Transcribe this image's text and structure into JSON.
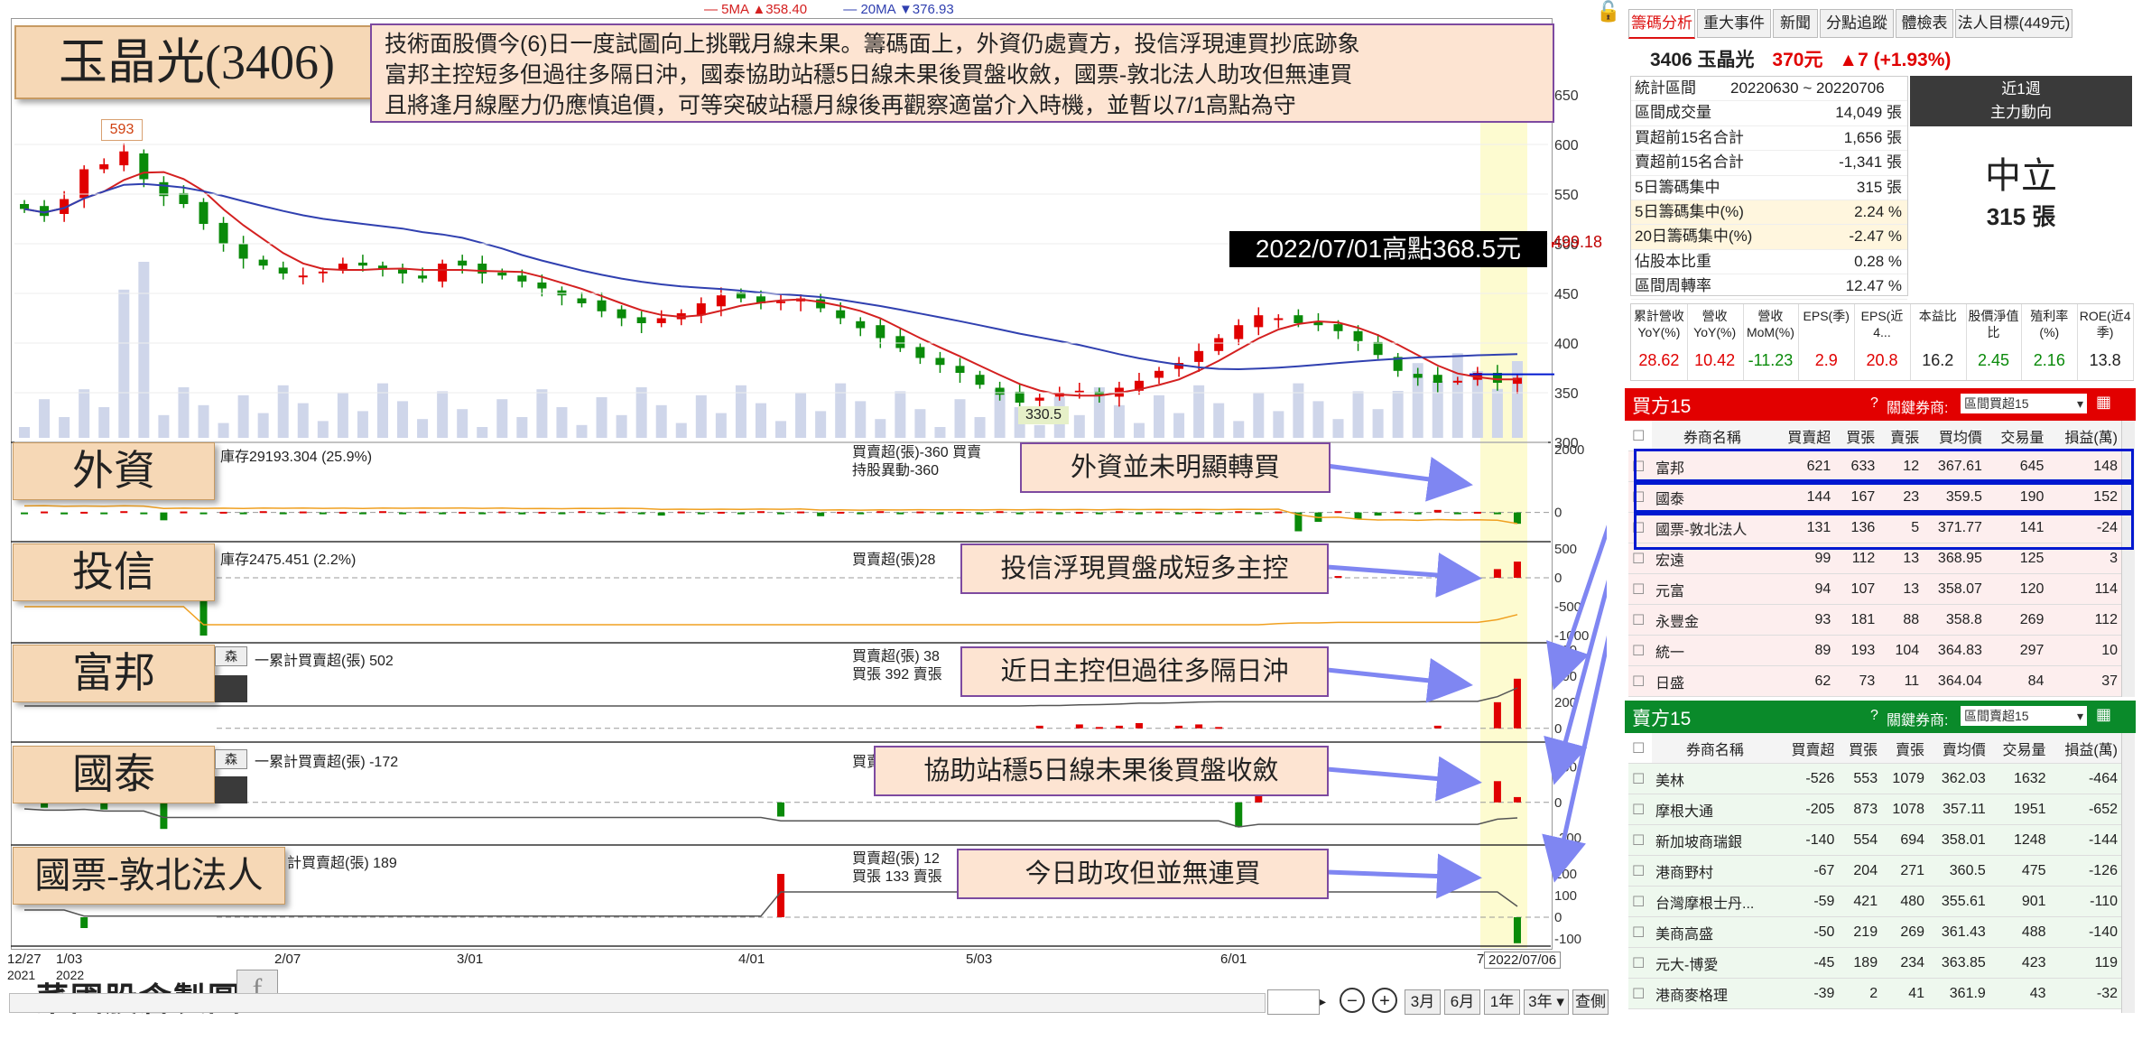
{
  "title": "玉晶光(3406)",
  "comment_lines": [
    "技術面股價今(6)日一度試圖向上挑戰月線未果。籌碼面上，外資仍處賣方，投信浮現連買抄底跡象",
    "富邦主控短多但過往多隔日沖，國泰協助站穩5日線未果後買盤收斂，國票-敦北法人助攻但無連買",
    "且將逢月線壓力仍應慎追價，可等突破站穩月線後再觀察適當介入時機，並暫以7/1高點為守"
  ],
  "ma_legend": {
    "ma5": "5MA ▲358.40",
    "ma20": "20MA ▼376.93"
  },
  "price_high_label": "593",
  "price_low_label": "330.5",
  "price_marker": "499.18",
  "high_callout": "2022/07/01高點368.5元",
  "panel_labels": [
    "外資",
    "投信",
    "富邦",
    "國泰",
    "國票-敦北法人"
  ],
  "callouts": [
    "外資並未明顯轉買",
    "投信浮現買盤成短多主控",
    "近日主控但過往多隔日沖",
    "協助站穩5日線未果後買盤收斂",
    "今日助攻但並無連買"
  ],
  "panel_info": {
    "foreign_left": "庫存29193.304 (25.9%)",
    "foreign_mid1": "買賣超(張)-360 買賣",
    "foreign_mid2": "持股異動-360",
    "trust_left": "庫存2475.451 (2.2%)",
    "trust_mid": "買賣超(張)28",
    "fubon_left": "一累計買賣超(張) 502",
    "fubon_mid1": "買賣超(張) 38",
    "fubon_mid2": "買張 392 賣張",
    "cathay_left": "一累計買賣超(張) -172",
    "cathay_mid": "買賣超(張)",
    "pbl_left": "計買賣超(張) 189",
    "pbl_mid1": "買賣超(張) 12",
    "pbl_mid2": "買張 133 賣張",
    "small_btn": "森"
  },
  "x_axis": {
    "labels": [
      "12/27",
      "1/03",
      "2/07",
      "3/01",
      "4/01",
      "5/03",
      "6/01",
      "7"
    ],
    "year_labels": [
      "2021",
      "2022"
    ],
    "current_date": "2022/07/06"
  },
  "watermark": "菜圃股倉製圖",
  "bottom_buttons": [
    "3月",
    "6月",
    "1年",
    "3年",
    "查側"
  ],
  "chart_data": [
    {
      "type": "candlestick",
      "title": "",
      "x_range": [
        "2021/12/27",
        "2022/07/06"
      ],
      "ylim": [
        300,
        650
      ],
      "y_ticks": [
        300,
        350,
        400,
        450,
        500,
        550,
        600,
        650
      ],
      "annotations": {
        "high": 593,
        "low": 330.5,
        "marker": 499.18,
        "ma5": 358.4,
        "ma20": 376.93
      },
      "close_path": [
        535,
        528,
        545,
        575,
        580,
        593,
        565,
        548,
        540,
        520,
        500,
        485,
        478,
        470,
        468,
        472,
        480,
        478,
        475,
        470,
        465,
        480,
        478,
        470,
        468,
        462,
        455,
        448,
        440,
        432,
        425,
        420,
        425,
        430,
        440,
        448,
        445,
        440,
        442,
        445,
        435,
        425,
        415,
        405,
        395,
        385,
        378,
        370,
        358,
        348,
        340,
        345,
        350,
        352,
        348,
        355,
        362,
        372,
        380,
        392,
        405,
        418,
        428,
        425,
        420,
        418,
        412,
        402,
        388,
        372,
        365,
        360,
        362,
        370,
        360,
        365
      ],
      "series": [
        {
          "name": "5MA",
          "color": "#d42020"
        },
        {
          "name": "20MA",
          "color": "#3040b0"
        }
      ]
    },
    {
      "type": "bar",
      "title": "外資",
      "values": [
        -40,
        30,
        -60,
        20,
        -20,
        40,
        -30,
        -250,
        30,
        -20,
        20,
        -30,
        40,
        -20,
        30,
        -40,
        20,
        -30,
        40,
        -20,
        30,
        -20,
        20,
        -40,
        30,
        -60,
        20,
        -30,
        40,
        -20,
        30,
        -20,
        -100,
        30,
        -20,
        20,
        -30,
        40,
        -20,
        30,
        -120,
        20,
        -30,
        40,
        -20,
        30,
        -20,
        20,
        -30,
        40,
        -20,
        30,
        -20,
        20,
        -30,
        40,
        -20,
        30,
        -20,
        20,
        -30,
        40,
        -20,
        30,
        -600,
        -300,
        40,
        -200,
        -100,
        30,
        -60,
        80,
        -50,
        20,
        -40,
        -360
      ],
      "ylim": [
        -700,
        2000
      ],
      "y_ticks": [
        0,
        2000
      ]
    },
    {
      "type": "bar",
      "title": "投信",
      "values": [
        0,
        0,
        0,
        0,
        0,
        0,
        0,
        0,
        0,
        -1000,
        0,
        0,
        0,
        0,
        0,
        0,
        0,
        0,
        0,
        0,
        0,
        0,
        0,
        0,
        0,
        0,
        0,
        0,
        0,
        0,
        0,
        0,
        0,
        0,
        0,
        0,
        0,
        0,
        0,
        0,
        0,
        0,
        0,
        0,
        0,
        0,
        0,
        0,
        0,
        0,
        0,
        0,
        0,
        0,
        0,
        0,
        0,
        0,
        0,
        0,
        0,
        0,
        0,
        60,
        40,
        0,
        30,
        0,
        0,
        0,
        0,
        0,
        0,
        0,
        150,
        280
      ],
      "ylim": [
        -1000,
        500
      ],
      "y_ticks": [
        500,
        0,
        -500,
        -1000
      ]
    },
    {
      "type": "bar",
      "title": "富邦",
      "values": [
        0,
        0,
        0,
        0,
        0,
        0,
        0,
        0,
        0,
        0,
        0,
        0,
        0,
        0,
        0,
        0,
        0,
        0,
        0,
        0,
        0,
        0,
        0,
        0,
        0,
        0,
        0,
        0,
        0,
        0,
        0,
        0,
        0,
        0,
        0,
        0,
        0,
        0,
        0,
        0,
        0,
        0,
        0,
        0,
        0,
        0,
        0,
        0,
        0,
        0,
        0,
        20,
        0,
        30,
        10,
        20,
        40,
        0,
        20,
        30,
        10,
        0,
        0,
        0,
        0,
        0,
        0,
        0,
        0,
        0,
        0,
        20,
        0,
        0,
        200,
        380
      ],
      "ylim": [
        -50,
        600
      ],
      "y_ticks": [
        0,
        200,
        400,
        600
      ]
    },
    {
      "type": "bar",
      "title": "國泰",
      "values": [
        0,
        -30,
        0,
        20,
        -40,
        0,
        0,
        -150,
        0,
        0,
        0,
        0,
        0,
        0,
        0,
        0,
        0,
        0,
        0,
        0,
        0,
        0,
        0,
        0,
        0,
        0,
        0,
        0,
        0,
        0,
        0,
        0,
        0,
        0,
        0,
        0,
        0,
        0,
        -80,
        0,
        0,
        0,
        0,
        0,
        0,
        0,
        0,
        0,
        0,
        0,
        0,
        0,
        0,
        0,
        0,
        0,
        0,
        0,
        0,
        0,
        0,
        -140,
        60,
        0,
        0,
        0,
        0,
        0,
        0,
        0,
        0,
        0,
        0,
        0,
        120,
        30
      ],
      "ylim": [
        -200,
        300
      ],
      "y_ticks": [
        200,
        0,
        -200
      ]
    },
    {
      "type": "bar",
      "title": "國票-敦北法人",
      "values": [
        0,
        0,
        0,
        -50,
        0,
        0,
        0,
        0,
        0,
        0,
        0,
        0,
        0,
        0,
        0,
        0,
        0,
        0,
        0,
        0,
        0,
        0,
        0,
        0,
        0,
        0,
        0,
        0,
        0,
        0,
        0,
        0,
        0,
        0,
        0,
        0,
        0,
        0,
        200,
        0,
        0,
        0,
        0,
        0,
        0,
        0,
        0,
        0,
        0,
        0,
        0,
        0,
        0,
        0,
        0,
        0,
        0,
        0,
        0,
        0,
        0,
        0,
        0,
        0,
        0,
        0,
        0,
        0,
        0,
        0,
        0,
        0,
        0,
        0,
        0,
        -120
      ],
      "ylim": [
        -100,
        300
      ],
      "y_ticks": [
        300,
        200,
        100,
        0,
        -100
      ]
    }
  ],
  "right_panel": {
    "tabs": [
      "籌碼分析",
      "重大事件",
      "新聞",
      "分點追蹤",
      "體檢表",
      "法人目標(449元)"
    ],
    "stock_code_name": "3406 玉晶光",
    "price": "370元",
    "change": "▲7 (+1.93%)",
    "stats": [
      [
        "統計區間",
        "20220630 ~ 20220706"
      ],
      [
        "區間成交量",
        "14,049 張"
      ],
      [
        "買超前15名合計",
        "1,656 張"
      ],
      [
        "賣超前15名合計",
        "-1,341 張"
      ],
      [
        "5日籌碼集中",
        "315 張"
      ],
      [
        "5日籌碼集中(%)",
        "2.24 %"
      ],
      [
        "20日籌碼集中(%)",
        "-2.47 %"
      ],
      [
        "佔股本比重",
        "0.28 %"
      ],
      [
        "區間周轉率",
        "12.47 %"
      ]
    ],
    "period": "近1週",
    "trend_title": "主力動向",
    "neutral": "中立",
    "neutral_value": "315 張",
    "metrics_headers": [
      "累計營收YoY(%)",
      "營收YoY(%)",
      "營收MoM(%)",
      "EPS(季)",
      "EPS(近4...",
      "本益比",
      "股價淨值比",
      "殖利率(%)",
      "ROE(近4季)"
    ],
    "metrics_values": [
      "28.62",
      "10.42",
      "-11.23",
      "2.9",
      "20.8",
      "16.2",
      "2.45",
      "2.16",
      "13.8"
    ],
    "buy_title": "買方15",
    "buy_filter_label": "關鍵券商:",
    "buy_filter_value": "區間買超15",
    "sell_title": "賣方15",
    "sell_filter_value": "區間賣超15",
    "table_headers": [
      "券商名稱",
      "買賣超",
      "買張",
      "賣張",
      "買均價",
      "交易量",
      "損益(萬)"
    ],
    "sell_headers": [
      "券商名稱",
      "買賣超",
      "買張",
      "賣張",
      "賣均價",
      "交易量",
      "損益(萬)"
    ],
    "buy_rows": [
      [
        "富邦",
        "621",
        "633",
        "12",
        "367.61",
        "645",
        "148"
      ],
      [
        "國泰",
        "144",
        "167",
        "23",
        "359.5",
        "190",
        "152"
      ],
      [
        "國票-敦北法人",
        "131",
        "136",
        "5",
        "371.77",
        "141",
        "-24"
      ],
      [
        "宏遠",
        "99",
        "112",
        "13",
        "368.95",
        "125",
        "3"
      ],
      [
        "元富",
        "94",
        "107",
        "13",
        "358.07",
        "120",
        "114"
      ],
      [
        "永豐金",
        "93",
        "181",
        "88",
        "358.8",
        "269",
        "112"
      ],
      [
        "統一",
        "89",
        "193",
        "104",
        "364.83",
        "297",
        "10"
      ],
      [
        "日盛",
        "62",
        "73",
        "11",
        "364.04",
        "84",
        "37"
      ]
    ],
    "sell_rows": [
      [
        "美林",
        "-526",
        "553",
        "1079",
        "362.03",
        "1632",
        "-464"
      ],
      [
        "摩根大通",
        "-205",
        "873",
        "1078",
        "357.11",
        "1951",
        "-652"
      ],
      [
        "新加坡商瑞銀",
        "-140",
        "554",
        "694",
        "358.01",
        "1248",
        "-144"
      ],
      [
        "港商野村",
        "-67",
        "204",
        "271",
        "360.5",
        "475",
        "-126"
      ],
      [
        "台灣摩根士丹...",
        "-59",
        "421",
        "480",
        "355.61",
        "901",
        "-110"
      ],
      [
        "美商高盛",
        "-50",
        "219",
        "269",
        "361.43",
        "488",
        "-140"
      ],
      [
        "元大-博愛",
        "-45",
        "189",
        "234",
        "363.85",
        "423",
        "119"
      ],
      [
        "港商麥格理",
        "-39",
        "2",
        "41",
        "361.9",
        "43",
        "-32"
      ]
    ]
  }
}
